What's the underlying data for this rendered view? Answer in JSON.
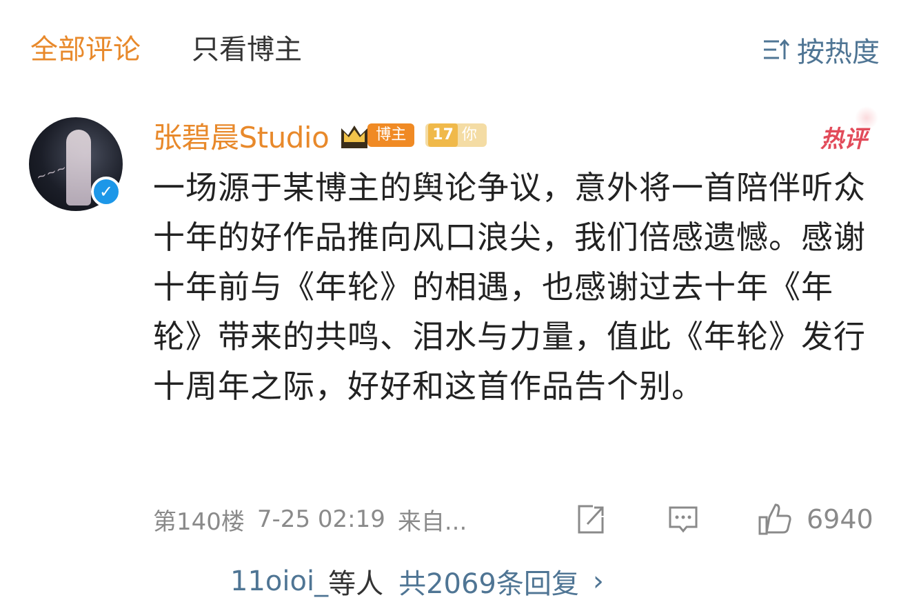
{
  "tabs": {
    "all_comments": "全部评论",
    "only_owner": "只看博主",
    "sort_label": "按热度"
  },
  "comment": {
    "author": "张碧晨Studio",
    "badge_owner": "博主",
    "badge_level": "17",
    "badge_level_text": "你",
    "hot_tag": "热评",
    "text": "一场源于某博主的舆论争议，意外将一首陪伴听众十年的好作品推向风口浪尖，我们倍感遗憾。感谢十年前与《年轮》的相遇，也感谢过去十年《年轮》带来的共鸣、泪水与力量，值此《年轮》发行十周年之际，好好和这首作品告个别。",
    "floor": "第140楼",
    "time": "7-25 02:19",
    "source": "来自...",
    "like_count": "6940",
    "replies_user": "11oioi_",
    "replies_etc": "等人",
    "replies_total": "共2069条回复"
  },
  "colors": {
    "accent_orange": "#e8892b",
    "link_blue": "#4f7594",
    "hot_red": "#e24b5a"
  },
  "icons": [
    "sort-icon",
    "crown-icon",
    "verified-icon",
    "share-icon",
    "reply-icon",
    "like-icon",
    "chevron-right-icon"
  ]
}
